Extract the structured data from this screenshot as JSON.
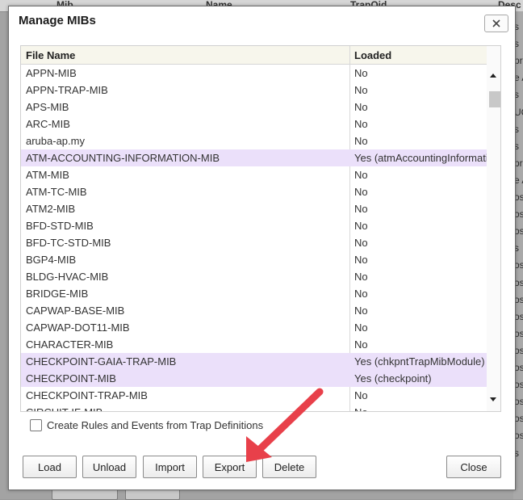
{
  "background": {
    "columns": [
      "Mib",
      "Name",
      "TrapOid",
      "Desc"
    ],
    "right_edge_rows": [
      "s",
      "s",
      "pro",
      "e A",
      "s",
      "UC",
      "s",
      "s",
      "pro",
      "e A",
      "os",
      "os",
      "os",
      "s",
      "os",
      "os",
      "os",
      "os",
      "os",
      "os",
      "os",
      "os",
      "os",
      "os",
      "os",
      "s"
    ]
  },
  "dialog": {
    "title": "Manage MIBs",
    "close_icon": "close-x-icon"
  },
  "grid": {
    "columns": [
      "File Name",
      "Loaded"
    ],
    "rows": [
      {
        "name": "APPN-MIB",
        "loaded": "No"
      },
      {
        "name": "APPN-TRAP-MIB",
        "loaded": "No"
      },
      {
        "name": "APS-MIB",
        "loaded": "No"
      },
      {
        "name": "ARC-MIB",
        "loaded": "No"
      },
      {
        "name": "aruba-ap.my",
        "loaded": "No"
      },
      {
        "name": "ATM-ACCOUNTING-INFORMATION-MIB",
        "loaded": "Yes (atmAccountingInformationMIB)",
        "highlighted": true
      },
      {
        "name": "ATM-MIB",
        "loaded": "No"
      },
      {
        "name": "ATM-TC-MIB",
        "loaded": "No"
      },
      {
        "name": "ATM2-MIB",
        "loaded": "No"
      },
      {
        "name": "BFD-STD-MIB",
        "loaded": "No"
      },
      {
        "name": "BFD-TC-STD-MIB",
        "loaded": "No"
      },
      {
        "name": "BGP4-MIB",
        "loaded": "No"
      },
      {
        "name": "BLDG-HVAC-MIB",
        "loaded": "No"
      },
      {
        "name": "BRIDGE-MIB",
        "loaded": "No"
      },
      {
        "name": "CAPWAP-BASE-MIB",
        "loaded": "No"
      },
      {
        "name": "CAPWAP-DOT11-MIB",
        "loaded": "No"
      },
      {
        "name": "CHARACTER-MIB",
        "loaded": "No"
      },
      {
        "name": "CHECKPOINT-GAIA-TRAP-MIB",
        "loaded": "Yes (chkpntTrapMibModule)",
        "highlighted": true
      },
      {
        "name": "CHECKPOINT-MIB",
        "loaded": "Yes (checkpoint)",
        "highlighted": true
      },
      {
        "name": "CHECKPOINT-TRAP-MIB",
        "loaded": "No"
      },
      {
        "name": "CIRCUIT-IF-MIB",
        "loaded": "No"
      }
    ],
    "highlight_color": "#ebe0fa"
  },
  "options": {
    "create_rules_label": "Create Rules and Events from Trap Definitions",
    "create_rules_checked": false
  },
  "buttons": {
    "load": "Load",
    "unload": "Unload",
    "import": "Import",
    "export": "Export",
    "delete": "Delete",
    "close": "Close"
  },
  "annotation": {
    "arrow_color": "#e8404a",
    "points_to": "export-button"
  }
}
